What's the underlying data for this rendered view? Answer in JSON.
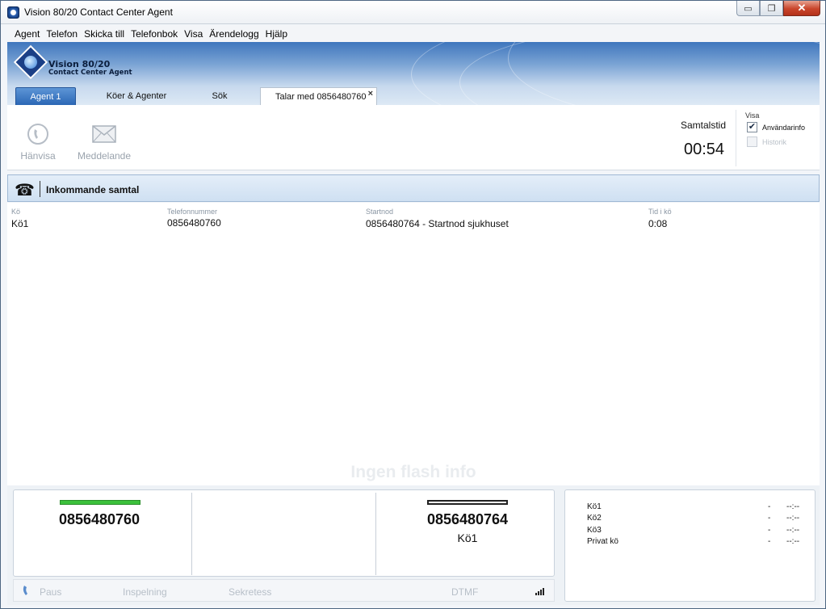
{
  "window": {
    "title": "Vision 80/20 Contact Center Agent",
    "minimize": "▭",
    "restore": "❐",
    "close": "✕"
  },
  "menu": [
    "Agent",
    "Telefon",
    "Skicka till",
    "Telefonbok",
    "Visa",
    "Ärendelogg",
    "Hjälp"
  ],
  "logo": {
    "line1": "Vision 80/20",
    "line2": "Contact Center Agent"
  },
  "tabs": {
    "agent": "Agent 1",
    "queues": "Köer & Agenter",
    "search": "Sök",
    "current": "Talar med 0856480760",
    "close": "×"
  },
  "toolbar": {
    "redirect_label": "Hänvisa",
    "message_label": "Meddelande",
    "talk_time_label": "Samtalstid",
    "talk_time_value": "00:54",
    "show_title": "Visa",
    "user_info_label": "Användarinfo",
    "user_info_checked": true,
    "history_label": "Historik",
    "history_checked": false,
    "check_mark": "✔"
  },
  "section": {
    "phone_glyph": "☎",
    "title": "Inkommande samtal"
  },
  "table": {
    "columns": [
      "Kö",
      "Telefonnummer",
      "Startnod",
      "Tid i kö"
    ],
    "row": [
      "Kö1",
      "0856480760",
      "0856480764 - Startnod sjukhuset",
      "0:08"
    ]
  },
  "watermark": "Ingen flash info",
  "lines": {
    "line1": {
      "number": "0856480760",
      "status_color": "#3cc13c"
    },
    "line3": {
      "number": "0856480764",
      "sub": "Kö1",
      "status_color": "#ffffff"
    }
  },
  "controls": {
    "pause": "Paus",
    "recording": "Inspelning",
    "privacy": "Sekretess",
    "dtmf": "DTMF"
  },
  "queues": [
    {
      "name": "Kö1",
      "count": "-",
      "time": "--:--"
    },
    {
      "name": "Kö2",
      "count": "-",
      "time": "--:--"
    },
    {
      "name": "Kö3",
      "count": "-",
      "time": "--:--"
    },
    {
      "name": "Privat kö",
      "count": "-",
      "time": "--:--"
    }
  ],
  "colors": {
    "accent_blue": "#2b67b5",
    "active_line": "#3cc13c"
  }
}
